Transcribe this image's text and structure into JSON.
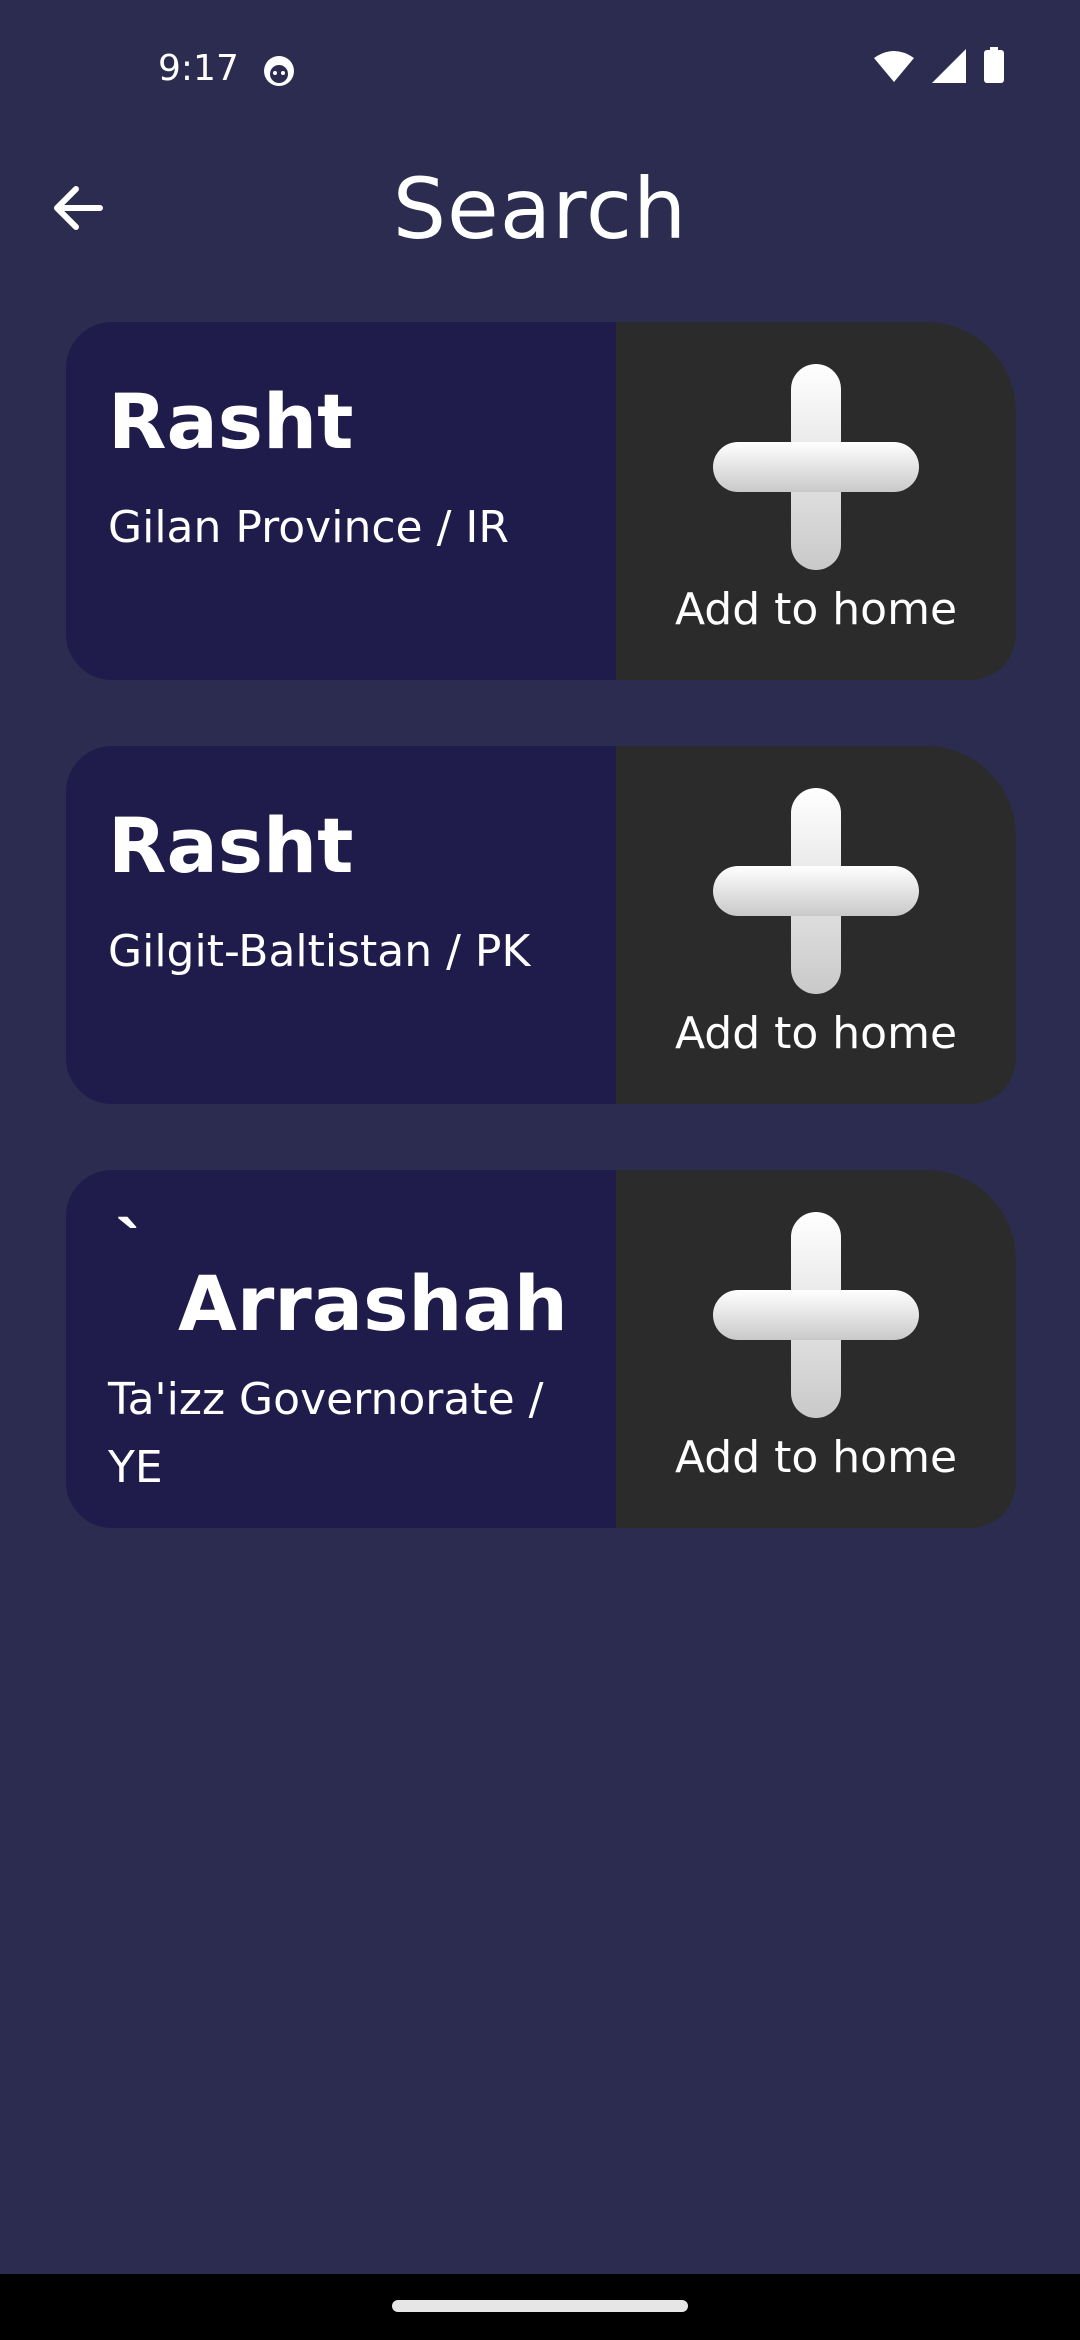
{
  "status_bar": {
    "time": "9:17",
    "icons": [
      "notification-icon",
      "wifi-icon",
      "signal-icon",
      "battery-icon"
    ]
  },
  "app_bar": {
    "title": "Search",
    "back_icon": "arrow-left-icon"
  },
  "results": [
    {
      "accent": "",
      "city": "Rasht",
      "region": "Gilan Province / IR",
      "action_label": "Add to home"
    },
    {
      "accent": "",
      "city": "Rasht",
      "region": "Gilgit-Baltistan / PK",
      "action_label": "Add to home"
    },
    {
      "accent": "`",
      "city": "Arrashah",
      "region": "Ta'izz Governorate / YE",
      "action_label": "Add to home"
    }
  ],
  "colors": {
    "background": "#2b2c4f",
    "card_info": "#1f1b4a",
    "card_action": "#2b2b2b",
    "text": "#ffffff"
  }
}
